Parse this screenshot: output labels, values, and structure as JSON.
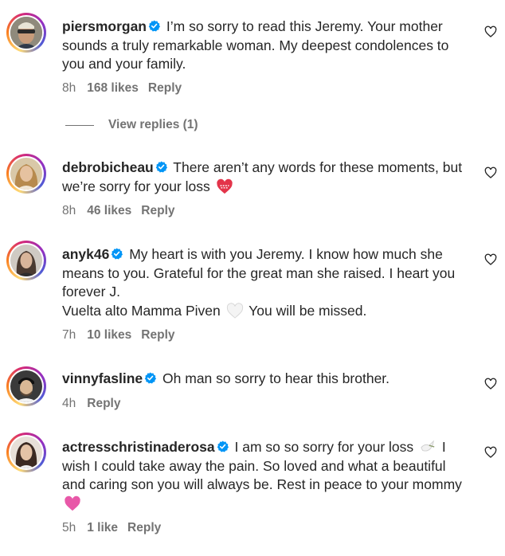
{
  "comments": [
    {
      "username": "piersmorgan",
      "text": "I’m so sorry to read this Jeremy. Your mother sounds a truly remarkable woman. My deepest condolences to you and your family.",
      "time": "8h",
      "likes": "168 likes",
      "reply": "Reply",
      "view_replies": "View replies (1)"
    },
    {
      "username": "debrobicheau",
      "text": "There aren’t any words for these moments, but we’re sorry for your loss",
      "emoji": "mending-heart",
      "time": "8h",
      "likes": "46 likes",
      "reply": "Reply"
    },
    {
      "username": "anyk46",
      "text": "My heart is with you Jeremy. I know how much she means to you. Grateful for the great man she raised. I heart you forever J.",
      "text2a": "Vuelta alto Mamma Piven",
      "emoji": "white-heart",
      "text2b": "You will be missed.",
      "time": "7h",
      "likes": "10 likes",
      "reply": "Reply"
    },
    {
      "username": "vinnyfasline",
      "text": "Oh man so sorry to hear this brother.",
      "time": "4h",
      "reply": "Reply"
    },
    {
      "username": "actresschristinaderosa",
      "text_a": "I am so so sorry for your loss",
      "emoji_a": "dove",
      "text_b": "I wish I could take away the pain. So loved and what a beautiful and caring son you will always be. Rest in peace to your mommy",
      "emoji_b": "pink-heart",
      "time": "5h",
      "likes": "1 like",
      "reply": "Reply"
    }
  ],
  "colors": {
    "text": "#262626",
    "muted": "#737373",
    "verified": "#0095f6"
  }
}
